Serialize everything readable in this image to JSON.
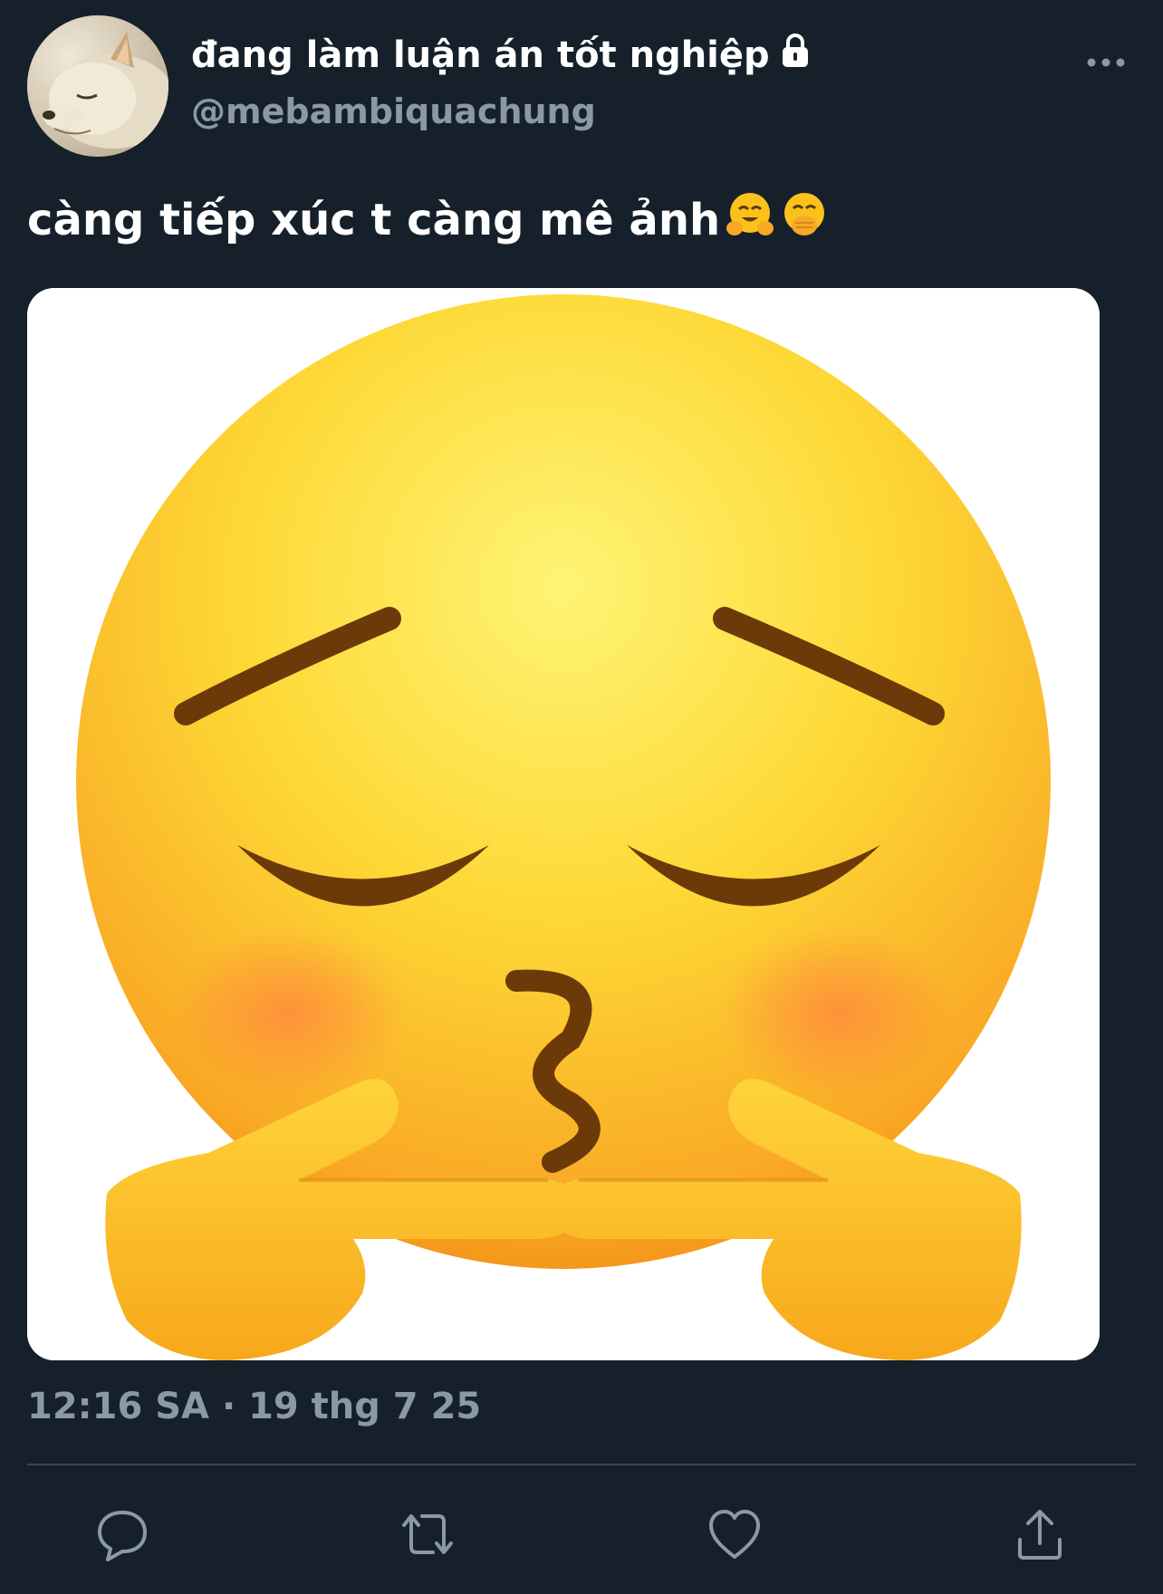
{
  "author": {
    "display_name": "đang làm luận án tốt nghiệp",
    "handle": "@mebambiquachung",
    "avatar_icon": "dog-avatar",
    "protected_icon": "lock-icon"
  },
  "tweet": {
    "text": "càng tiếp xúc t càng mê ảnh",
    "emojis": [
      "hugging-face-icon",
      "face-with-hand-over-mouth-icon"
    ],
    "media_icon": "kissing-face-with-fingers-touching-emoji",
    "timestamp": "12:16 SA · 19 thg 7 25"
  },
  "actions": [
    {
      "name": "reply-button",
      "icon": "speech-bubble-icon"
    },
    {
      "name": "retweet-button",
      "icon": "retweet-icon"
    },
    {
      "name": "like-button",
      "icon": "heart-icon"
    },
    {
      "name": "share-button",
      "icon": "share-icon"
    }
  ],
  "colors": {
    "background": "#15202b",
    "primary_text": "#ffffff",
    "secondary_text": "#8b98a5",
    "divider": "#38444d",
    "icon": "#8b98a5"
  }
}
